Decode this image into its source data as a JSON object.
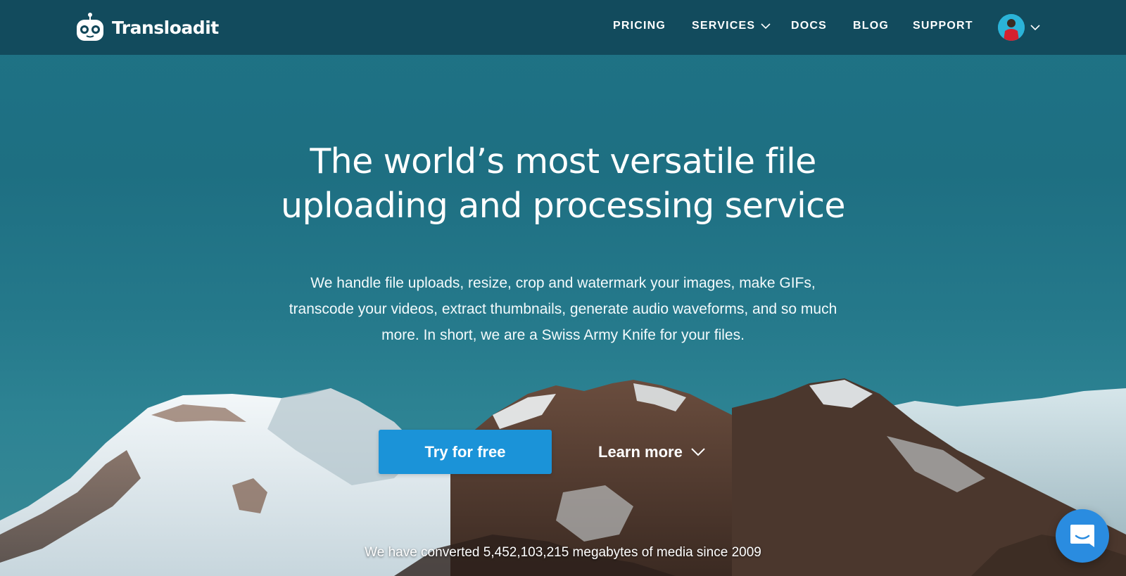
{
  "brand": {
    "name": "Transloadit",
    "logo_icon": "robot-icon"
  },
  "nav": {
    "items": [
      {
        "label": "PRICING"
      },
      {
        "label": "SERVICES",
        "has_dropdown": true
      },
      {
        "label": "DOCS"
      },
      {
        "label": "BLOG"
      },
      {
        "label": "SUPPORT"
      }
    ],
    "account_icon": "avatar"
  },
  "hero": {
    "headline_line1": "The world’s most versatile file",
    "headline_line2": "uploading and processing service",
    "description_line1": "We handle file uploads, resize, crop and watermark your images, make GIFs,",
    "description_line2": "transcode your videos, extract thumbnails, generate audio waveforms, and so much",
    "description_line3": "more. In short, we are a Swiss Army Knife for your files.",
    "primary_cta": "Try for free",
    "secondary_cta": "Learn more",
    "stats": "We have converted 5,452,103,215 megabytes of media since 2009"
  },
  "colors": {
    "topbar": "#114658",
    "hero_background": "#1f7386",
    "primary_button": "#1b93d8",
    "chat_button": "#2a8ce0"
  },
  "chat": {
    "icon": "chat-icon"
  }
}
